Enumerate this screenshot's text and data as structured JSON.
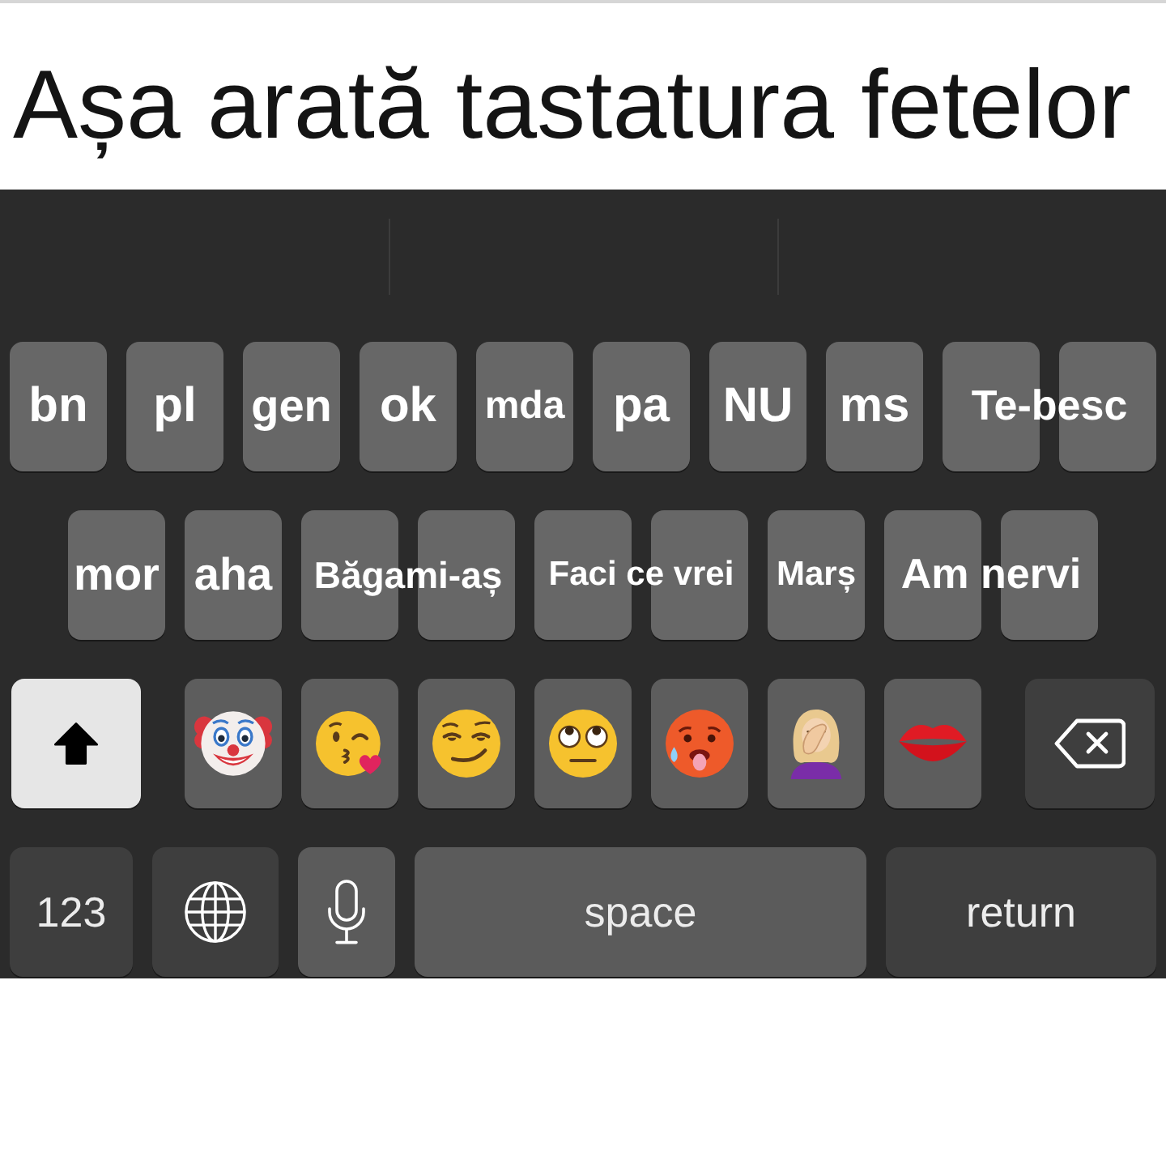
{
  "title": "Așa arată tastatura fetelor",
  "keyboard": {
    "rows": [
      {
        "keys": [
          {
            "kind": "word",
            "label": "bn"
          },
          {
            "kind": "word",
            "label": "pl"
          },
          {
            "kind": "word",
            "label": "gen"
          },
          {
            "kind": "word",
            "label": "ok"
          },
          {
            "kind": "word",
            "label": "mda"
          },
          {
            "kind": "word",
            "label": "pa"
          },
          {
            "kind": "word",
            "label": "NU"
          },
          {
            "kind": "word",
            "label": "ms"
          },
          {
            "kind": "phrase",
            "label": "Te-besc"
          },
          {
            "kind": "blank"
          }
        ]
      },
      {
        "keys": [
          {
            "kind": "word",
            "label": "mor"
          },
          {
            "kind": "word",
            "label": "aha"
          },
          {
            "kind": "phrase",
            "label": "Băgami-aș"
          },
          {
            "kind": "blank"
          },
          {
            "kind": "phrase",
            "label": "Faci ce vrei"
          },
          {
            "kind": "blank"
          },
          {
            "kind": "word",
            "label": "Marș"
          },
          {
            "kind": "phrase",
            "label": "Am nervi"
          },
          {
            "kind": "blank"
          }
        ]
      },
      {
        "keys": [
          {
            "kind": "shift",
            "on": true
          },
          {
            "kind": "emoji"
          },
          {
            "kind": "emoji"
          },
          {
            "kind": "emoji"
          },
          {
            "kind": "emoji"
          },
          {
            "kind": "emoji"
          },
          {
            "kind": "emoji"
          },
          {
            "kind": "emoji"
          },
          {
            "kind": "backspace"
          }
        ]
      },
      {
        "keys": [
          {
            "kind": "numbers",
            "label": "123"
          },
          {
            "kind": "globe"
          },
          {
            "kind": "mic"
          },
          {
            "kind": "space",
            "label": "space"
          },
          {
            "kind": "return",
            "label": "return"
          }
        ]
      }
    ]
  }
}
